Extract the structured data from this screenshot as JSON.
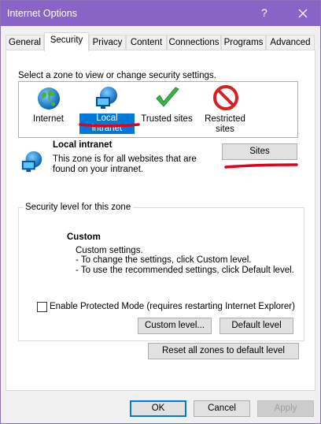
{
  "window": {
    "title": "Internet Options",
    "help_glyph": "?",
    "close_glyph": "✕"
  },
  "tabs": [
    {
      "label": "General"
    },
    {
      "label": "Security"
    },
    {
      "label": "Privacy"
    },
    {
      "label": "Content"
    },
    {
      "label": "Connections"
    },
    {
      "label": "Programs"
    },
    {
      "label": "Advanced"
    }
  ],
  "zones": {
    "instruction": "Select a zone to view or change security settings.",
    "items": [
      {
        "label": "Internet",
        "icon": "globe-icon"
      },
      {
        "label": "Local intranet",
        "icon": "intranet-icon",
        "selected": true
      },
      {
        "label": "Trusted sites",
        "icon": "checkmark-icon"
      },
      {
        "label": "Restricted sites",
        "icon": "restricted-icon"
      }
    ]
  },
  "zone_info": {
    "name": "Local intranet",
    "description": "This zone is for all websites that are found on your intranet.",
    "sites_button": "Sites"
  },
  "security_level": {
    "group_title": "Security level for this zone",
    "level_name": "Custom",
    "lines": [
      "Custom settings.",
      "- To change the settings, click Custom level.",
      "- To use the recommended settings, click Default level."
    ],
    "protected_mode_label": "Enable Protected Mode (requires restarting Internet Explorer)",
    "protected_mode_checked": false,
    "custom_level_button": "Custom level...",
    "default_level_button": "Default level",
    "reset_all_button": "Reset all zones to default level"
  },
  "footer": {
    "ok": "OK",
    "cancel": "Cancel",
    "apply": "Apply"
  },
  "colors": {
    "titlebar": "#8a63c7",
    "selection": "#0078d7",
    "annotation": "#e4001b"
  }
}
